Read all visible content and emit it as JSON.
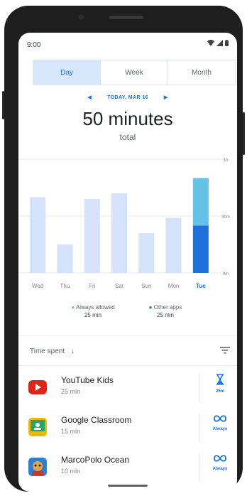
{
  "status_bar": {
    "time": "9:00"
  },
  "tabs": [
    {
      "label": "Day",
      "selected": true
    },
    {
      "label": "Week",
      "selected": false
    },
    {
      "label": "Month",
      "selected": false
    }
  ],
  "date_nav": {
    "label": "TODAY, MAR 16"
  },
  "summary": {
    "total": "50 minutes",
    "total_caption": "total"
  },
  "chart_data": {
    "type": "bar",
    "categories": [
      "Wed",
      "Thu",
      "Fri",
      "Sat",
      "Sun",
      "Mon",
      "Tue"
    ],
    "series": [
      {
        "name": "Always allowed",
        "values": [
          0,
          0,
          0,
          0,
          0,
          0,
          25
        ]
      },
      {
        "name": "Other apps",
        "values": [
          40,
          15,
          39,
          42,
          21,
          29,
          25
        ]
      }
    ],
    "y_tick_labels": [
      "1h",
      "30m",
      "0m"
    ],
    "ylim": [
      0,
      60
    ],
    "highlight_category": "Tue",
    "colors": {
      "past": "#d4e2fa",
      "always_allowed": "#1e6fd9",
      "other_apps": "#64c2e8",
      "highlight_label": "#1a73e8"
    }
  },
  "legend": [
    {
      "name": "Always allowed",
      "value": "25 min",
      "color": "#64c2e8"
    },
    {
      "name": "Other apps",
      "value": "25 min",
      "color": "#1e6fd9"
    }
  ],
  "list_header": {
    "label": "Time spent"
  },
  "apps": [
    {
      "name": "YouTube Kids",
      "time": "25 min",
      "action": "25m",
      "icon": "youtube-kids-icon",
      "action_icon": "hourglass-icon"
    },
    {
      "name": "Google Classroom",
      "time": "15 min",
      "action": "Always",
      "icon": "google-classroom-icon",
      "action_icon": "infinity-icon"
    },
    {
      "name": "MarcoPolo Ocean",
      "time": "10 min",
      "action": "Always",
      "icon": "marcopolo-ocean-icon",
      "action_icon": "infinity-icon"
    }
  ]
}
